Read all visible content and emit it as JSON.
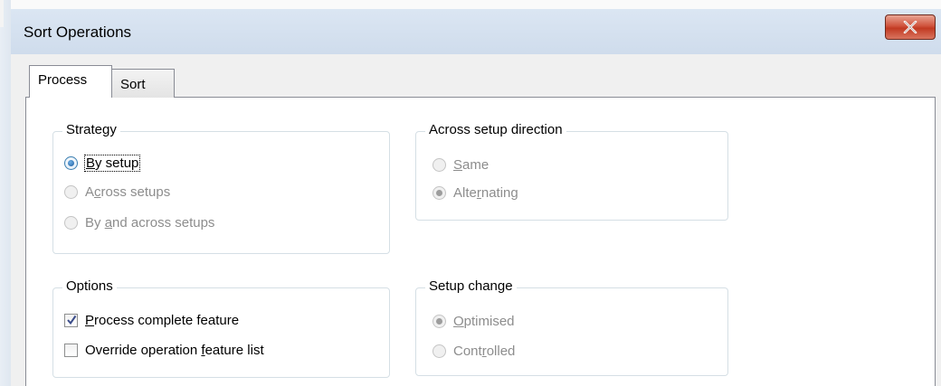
{
  "window": {
    "title": "Sort Operations"
  },
  "tabs": [
    {
      "label": "Process",
      "selected": true
    },
    {
      "label": "Sort",
      "selected": false
    }
  ],
  "strategy": {
    "legend": "Strategy",
    "options": [
      {
        "pre": "",
        "key": "B",
        "post": "y setup",
        "checked": true,
        "enabled": true
      },
      {
        "pre": "A",
        "key": "c",
        "post": "ross setups",
        "checked": false,
        "enabled": false
      },
      {
        "pre": "By ",
        "key": "a",
        "post": "nd across setups",
        "checked": false,
        "enabled": false
      }
    ]
  },
  "across_setup_direction": {
    "legend": "Across setup direction",
    "options": [
      {
        "pre": "",
        "key": "S",
        "post": "ame",
        "checked": false,
        "enabled": false
      },
      {
        "pre": "Alte",
        "key": "r",
        "post": "nating",
        "checked": true,
        "enabled": false
      }
    ]
  },
  "options_group": {
    "legend": "Options",
    "options": [
      {
        "pre": "",
        "key": "P",
        "post": "rocess complete feature",
        "checked": true,
        "enabled": true
      },
      {
        "pre": "Override operation ",
        "key": "f",
        "post": "eature list",
        "checked": false,
        "enabled": true
      }
    ]
  },
  "setup_change": {
    "legend": "Setup change",
    "options": [
      {
        "pre": "",
        "key": "O",
        "post": "ptimised",
        "checked": true,
        "enabled": false
      },
      {
        "pre": "Cont",
        "key": "r",
        "post": "olled",
        "checked": false,
        "enabled": false
      }
    ]
  },
  "colors": {
    "title_bar": "#cfdcec",
    "close_button": "#c13a22",
    "disabled_text": "#8d8d8d",
    "radio_selected": "#1b5a9c"
  }
}
